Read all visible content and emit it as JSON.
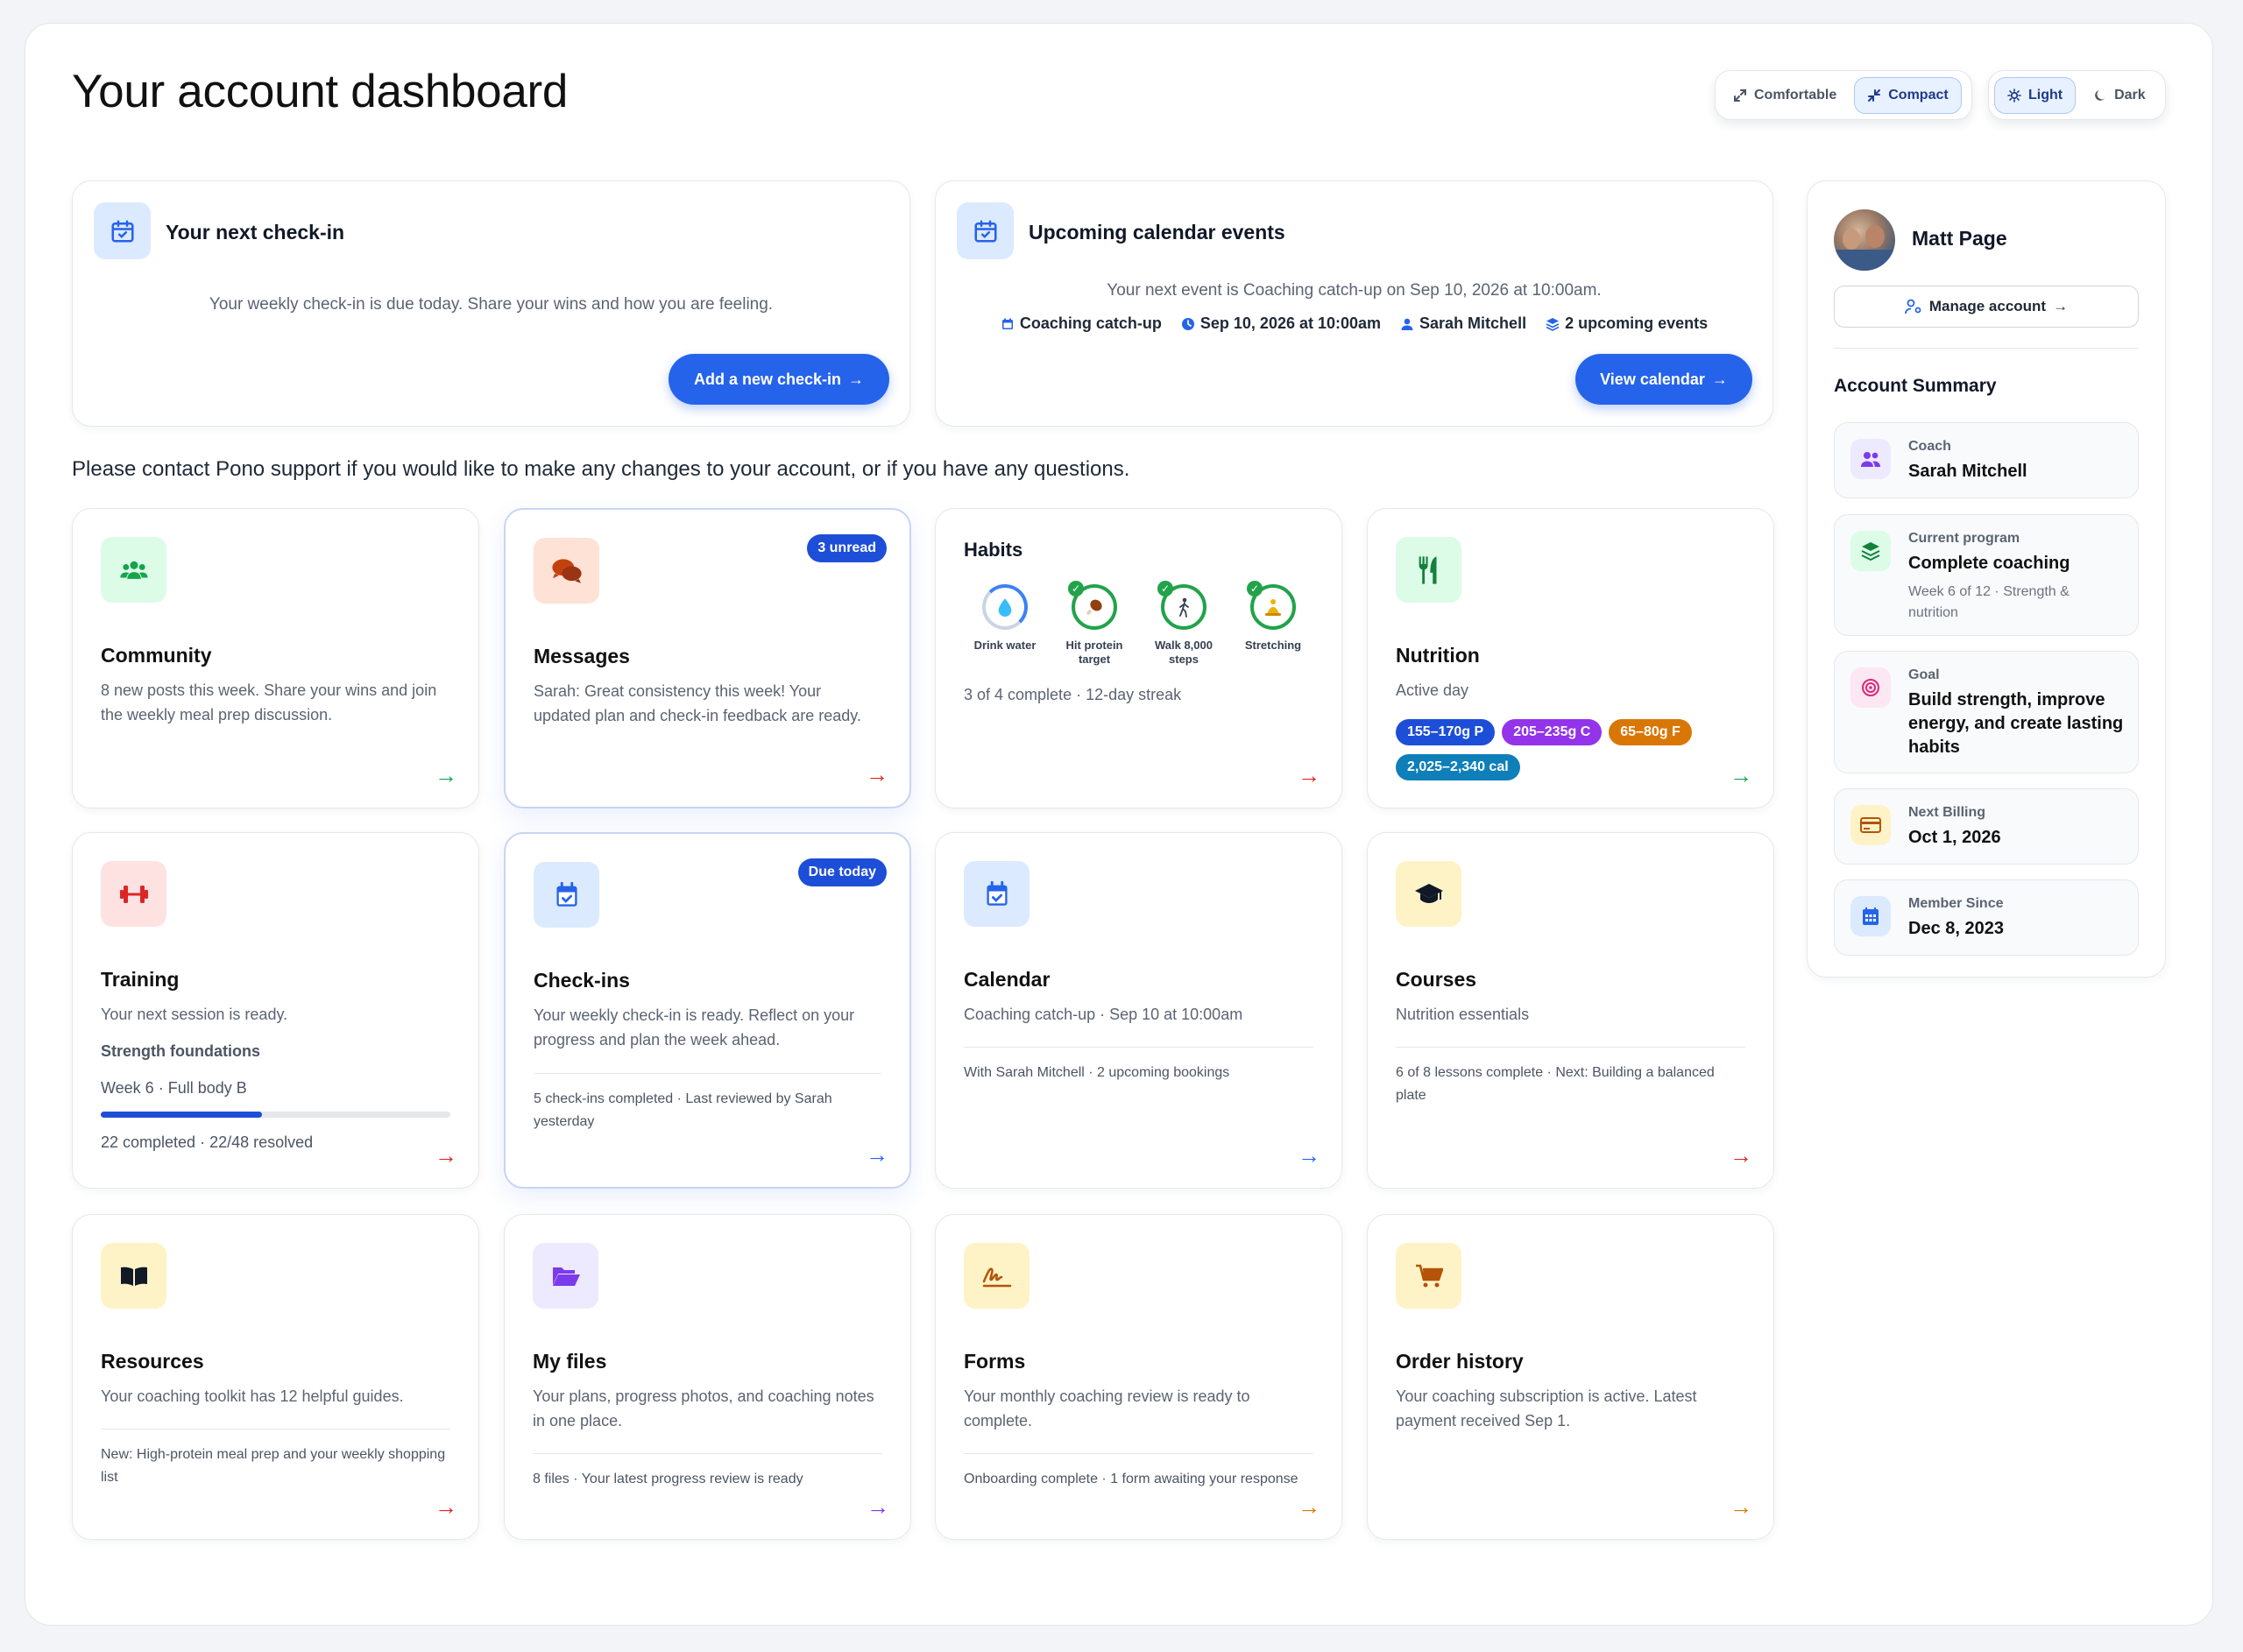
{
  "page": {
    "title": "Your account dashboard"
  },
  "density": {
    "comfortable": "Comfortable",
    "compact": "Compact",
    "selected": "Compact"
  },
  "theme": {
    "light": "Light",
    "dark": "Dark",
    "selected": "Light"
  },
  "checkin_card": {
    "title": "Your next check-in",
    "text": "Your weekly check-in is due today. Share your wins and how you are feeling.",
    "button": "Add a new check-in"
  },
  "calendar_card": {
    "title": "Upcoming calendar events",
    "text": "Your next event is Coaching catch-up on Sep 10, 2026 at 10:00am.",
    "meta": [
      "Coaching catch-up",
      "Sep 10, 2026 at 10:00am",
      "Sarah Mitchell",
      "2 upcoming events"
    ],
    "button": "View calendar"
  },
  "support_text": "Please contact Pono support if you would like to make any changes to your account, or if you have any questions.",
  "tiles": {
    "community": {
      "title": "Community",
      "desc": "8 new posts this week. Share your wins and join the weekly meal prep discussion."
    },
    "messages": {
      "title": "Messages",
      "badge": "3 unread",
      "desc": "Sarah: Great consistency this week! Your updated plan and check-in feedback are ready."
    },
    "habits": {
      "title": "Habits",
      "items": [
        {
          "label": "Drink water",
          "done": false,
          "progress": 0.6
        },
        {
          "label": "Hit protein target",
          "done": true,
          "progress": 1
        },
        {
          "label": "Walk 8,000 steps",
          "done": true,
          "progress": 1
        },
        {
          "label": "Stretching",
          "done": true,
          "progress": 1
        }
      ],
      "summary": "3 of 4 complete · 12-day streak"
    },
    "nutrition": {
      "title": "Nutrition",
      "desc": "Active day",
      "chips": [
        {
          "label": "155–170g P",
          "color": "#1d4ed8"
        },
        {
          "label": "205–235g C",
          "color": "#9333ea"
        },
        {
          "label": "65–80g F",
          "color": "#d97706"
        },
        {
          "label": "2,025–2,340 cal",
          "color": "#0e7fb8"
        }
      ]
    },
    "training": {
      "title": "Training",
      "desc": "Your next session is ready.",
      "program": "Strength foundations",
      "week": "Week 6 · Full body B",
      "progress": 0.46,
      "foot": "22 completed · 22/48 resolved"
    },
    "checkins": {
      "title": "Check-ins",
      "badge": "Due today",
      "desc": "Your weekly check-in is ready. Reflect on your progress and plan the week ahead.",
      "foot": "5 check-ins completed · Last reviewed by Sarah yesterday"
    },
    "calendar": {
      "title": "Calendar",
      "desc": "Coaching catch-up · Sep 10 at 10:00am",
      "foot": "With Sarah Mitchell · 2 upcoming bookings"
    },
    "courses": {
      "title": "Courses",
      "desc": "Nutrition essentials",
      "foot": "6 of 8 lessons complete · Next: Building a balanced plate"
    },
    "resources": {
      "title": "Resources",
      "desc": "Your coaching toolkit has 12 helpful guides.",
      "foot": "New: High-protein meal prep and your weekly shopping list"
    },
    "files": {
      "title": "My files",
      "desc": "Your plans, progress photos, and coaching notes in one place.",
      "foot": "8 files · Your latest progress review is ready"
    },
    "forms": {
      "title": "Forms",
      "desc": "Your monthly coaching review is ready to complete.",
      "foot": "Onboarding complete · 1 form awaiting your response"
    },
    "orders": {
      "title": "Order history",
      "desc": "Your coaching subscription is active. Latest payment received Sep 1."
    }
  },
  "profile": {
    "name": "Matt Page",
    "manage": "Manage account",
    "summary_title": "Account Summary",
    "coach": {
      "label": "Coach",
      "value": "Sarah Mitchell"
    },
    "program": {
      "label": "Current program",
      "value": "Complete coaching",
      "sub": "Week 6 of 12 · Strength & nutrition"
    },
    "goal": {
      "label": "Goal",
      "value": "Build strength, improve energy, and create lasting habits"
    },
    "billing": {
      "label": "Next Billing",
      "value": "Oct 1, 2026"
    },
    "member": {
      "label": "Member Since",
      "value": "Dec 8, 2023"
    }
  },
  "colors": {
    "accent": "#2563eb",
    "arrow_green": "#16a34a",
    "arrow_red": "#dc2626",
    "arrow_blue": "#2563eb",
    "arrow_purple": "#7c3aed",
    "arrow_orange": "#d97706"
  }
}
